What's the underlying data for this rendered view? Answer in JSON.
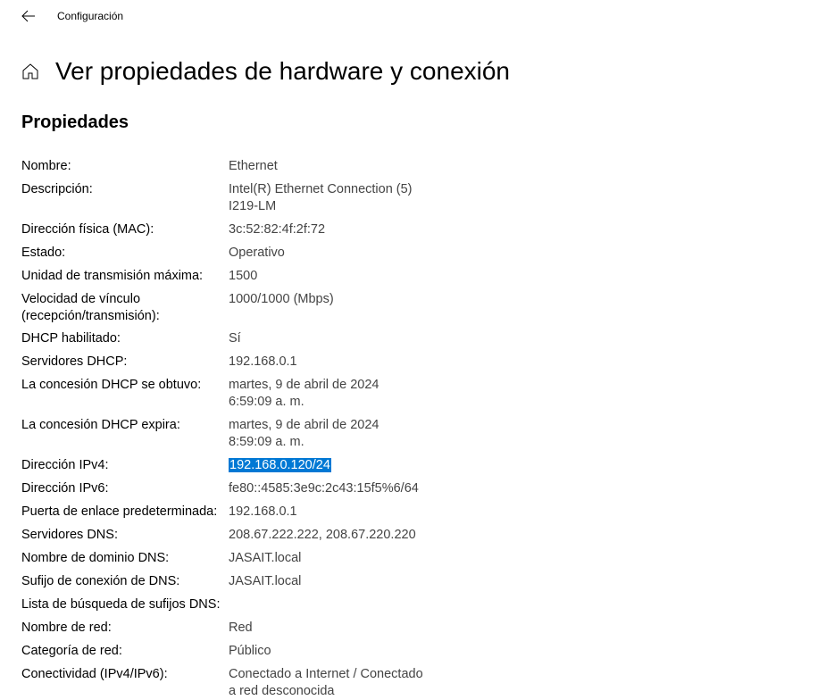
{
  "header": {
    "back_aria": "Back",
    "title": "Configuración"
  },
  "page": {
    "title": "Ver propiedades de hardware y conexión",
    "section_heading": "Propiedades"
  },
  "properties": [
    {
      "label": "Nombre:",
      "value": "Ethernet"
    },
    {
      "label": "Descripción:",
      "value": "Intel(R) Ethernet Connection (5) I219-LM"
    },
    {
      "label": "Dirección física (MAC):",
      "value": "3c:52:82:4f:2f:72"
    },
    {
      "label": "Estado:",
      "value": "Operativo"
    },
    {
      "label": "Unidad de transmisión máxima:",
      "value": "1500"
    },
    {
      "label": "Velocidad de vínculo (recepción/transmisión):",
      "value": "1000/1000 (Mbps)"
    },
    {
      "label": "DHCP habilitado:",
      "value": "Sí"
    },
    {
      "label": "Servidores DHCP:",
      "value": "192.168.0.1"
    },
    {
      "label": "La concesión DHCP se obtuvo:",
      "value": "martes, 9 de abril de 2024 6:59:09 a. m."
    },
    {
      "label": "La concesión DHCP expira:",
      "value": "martes, 9 de abril de 2024 8:59:09 a. m."
    },
    {
      "label": "Dirección IPv4:",
      "value": "192.168.0.120/24",
      "highlighted": true
    },
    {
      "label": "Dirección IPv6:",
      "value": "fe80::4585:3e9c:2c43:15f5%6/64"
    },
    {
      "label": "Puerta de enlace predeterminada:",
      "value": "192.168.0.1"
    },
    {
      "label": "Servidores DNS:",
      "value": "208.67.222.222, 208.67.220.220"
    },
    {
      "label": "Nombre de dominio DNS:",
      "value": "JASAIT.local"
    },
    {
      "label": "Sufijo de conexión de DNS:",
      "value": "JASAIT.local"
    },
    {
      "label": "Lista de búsqueda de sufijos DNS:",
      "value": ""
    },
    {
      "label": "Nombre de red:",
      "value": "Red"
    },
    {
      "label": "Categoría de red:",
      "value": "Público"
    },
    {
      "label": "Conectividad (IPv4/IPv6):",
      "value": "Conectado a Internet / Conectado a red desconocida"
    }
  ]
}
